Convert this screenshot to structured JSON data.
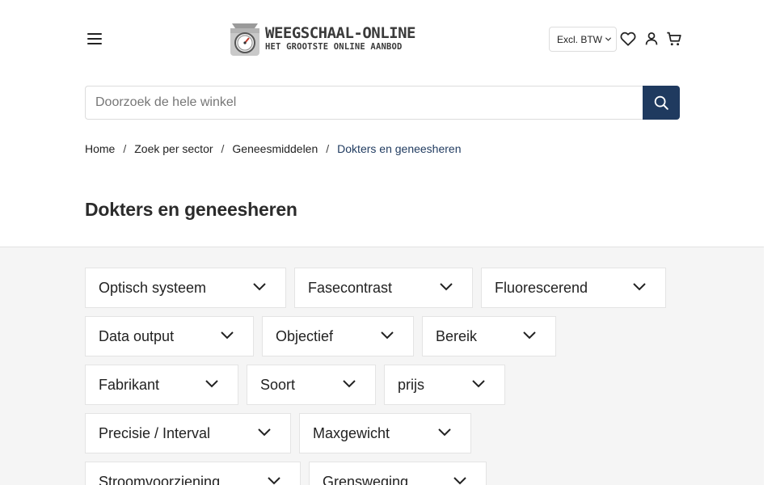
{
  "header": {
    "menu_icon": "hamburger-menu-icon",
    "logo": {
      "line1": "WEEGSCHAAL-ONLINE",
      "line2": "HET GROOTSTE ONLINE AANBOD",
      "icon": "kitchen-scale-icon"
    },
    "vat_select": {
      "value": "Excl. BTW",
      "icon": "chevron-down-icon"
    },
    "icons": [
      "heart-icon",
      "user-icon",
      "cart-icon"
    ]
  },
  "search": {
    "placeholder": "Doorzoek de hele winkel",
    "value": "",
    "button_icon": "search-icon",
    "button_color": "#1f3a5f"
  },
  "breadcrumb": {
    "items": [
      "Home",
      "Zoek per sector",
      "Geneesmiddelen",
      "Dokters en geneesheren"
    ],
    "separator": "/"
  },
  "page": {
    "title": "Dokters en geneesheren"
  },
  "filters": {
    "items": [
      {
        "label": "Optisch systeem"
      },
      {
        "label": "Fasecontrast"
      },
      {
        "label": "Fluorescerend"
      },
      {
        "label": "Data output"
      },
      {
        "label": "Objectief"
      },
      {
        "label": "Bereik"
      },
      {
        "label": "Fabrikant"
      },
      {
        "label": "Soort"
      },
      {
        "label": "prijs"
      },
      {
        "label": "Precisie / Interval"
      },
      {
        "label": "Maxgewicht"
      },
      {
        "label": "Stroomvoorziening"
      },
      {
        "label": "Grensweging"
      }
    ]
  },
  "colors": {
    "accent": "#1f3a5f",
    "filter_bg": "#f5f5f5"
  }
}
